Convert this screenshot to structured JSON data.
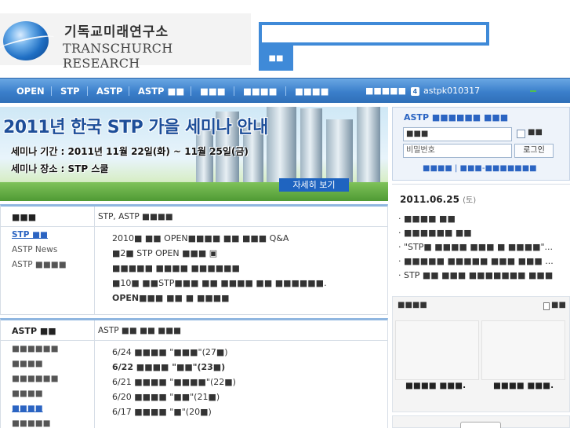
{
  "header": {
    "logo_korean": "기독교미래연구소",
    "logo_english": "TRANSCHURCH RESEARCH",
    "search_value": "",
    "search_button": "■■"
  },
  "nav": {
    "items": [
      "OPEN",
      "STP",
      "ASTP",
      "ASTP ■■",
      "■■■",
      "■■■■",
      "■■■■"
    ],
    "status_label": "■■■■■",
    "badge": "4",
    "username": "astpk010317"
  },
  "banner": {
    "title": "2011년 한국 STP 가을 세미나 안내",
    "line1": "세미나 기간 : 2011년 11월 22일(화) ~ 11월 25일(금)",
    "line2": "세미나 장소 : STP 스쿨",
    "more_button": "자세히 보기"
  },
  "stp_section": {
    "header_left": "■■■",
    "header_right": "STP, ASTP ■■■■",
    "side": [
      "STP ■■",
      "ASTP News",
      "ASTP ■■■■"
    ],
    "items": [
      "2010■ ■■ OPEN■■■■ ■■ ■■■ Q&A",
      "■2■ STP OPEN ■■■ ▣",
      "■■■■■ ■■■■ ■■■■■■",
      "■10■ ■■STP■■■ ■■ ■■■■ ■■ ■■■■■■.",
      "OPEN■■■ ■■ ■ ■■■■"
    ]
  },
  "astp_section": {
    "header_left": "ASTP ■■",
    "header_right": "ASTP ■■ ■■ ■■■",
    "side": [
      "■■■■■■",
      "■■■■",
      "■■■■■■",
      "■■■■",
      "■■■■",
      "■■■■■"
    ],
    "items": [
      "6/24 ■■■■ \"■■■\"(27■)",
      "6/22 ■■■■ \"■■\"(23■)",
      "6/21 ■■■■ \"■■■■\"(22■)",
      "6/20 ■■■■ \"■■\"(21■)",
      "6/17 ■■■■ \"■\"(20■)"
    ]
  },
  "login": {
    "title": "ASTP ■■■■■■ ■■■",
    "id_value": "■■■",
    "pw_placeholder": "비밀번호",
    "remember_label": "■■",
    "login_button": "로그인",
    "links": "■■■■ | ■■■-■■■■■■■"
  },
  "notice": {
    "date": "2011.06.25",
    "dow": "(토)",
    "items": [
      "· ■■■■ ■■",
      "· ■■■■■■ ■■",
      "· \"STP■ ■■■■ ■■■ ■ ■■■■\"...",
      "· ■■■■■ ■■■■■ ■■■ ■■■ ...",
      "· STP ■■ ■■■ ■■■■■■■ ■■■"
    ]
  },
  "right_box": {
    "title": "■■■■",
    "icon_label": "■■",
    "caption_left": "■■■■ ■■■.",
    "caption_right": "■■■■ ■■■."
  }
}
